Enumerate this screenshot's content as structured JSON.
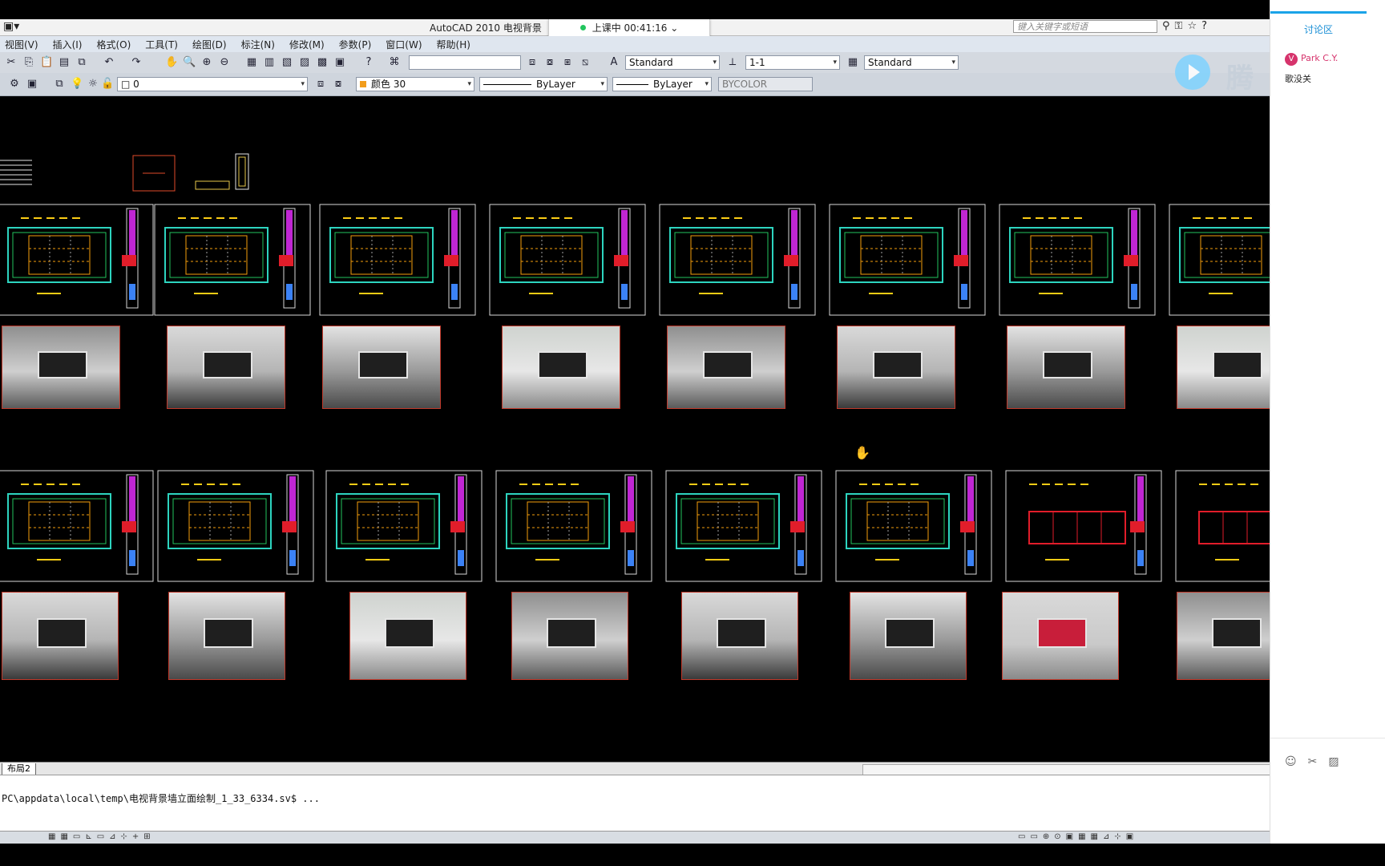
{
  "titlebar": {
    "title": "AutoCAD 2010    电视背景",
    "search_placeholder": "键入关键字或短语",
    "icons": [
      "binoculars-icon",
      "key-icon",
      "star-icon",
      "help-icon"
    ]
  },
  "timer": {
    "label": "上课中 00:41:16",
    "status_color": "#22c55e"
  },
  "menu": [
    "视图(V)",
    "插入(I)",
    "格式(O)",
    "工具(T)",
    "绘图(D)",
    "标注(N)",
    "修改(M)",
    "参数(P)",
    "窗口(W)",
    "帮助(H)"
  ],
  "toolbar1": {
    "text_style": "Standard",
    "dim_scale": "1-1",
    "table_style": "Standard"
  },
  "toolbar2": {
    "layer": "0",
    "color": "颜色 30",
    "linetype": "ByLayer",
    "lineweight": "ByLayer",
    "plotstyle": "BYCOLOR"
  },
  "logo": {
    "text": "腾讯"
  },
  "layout_tab": "布局2",
  "command_line": "PC\\appdata\\local\\temp\\电视背景墙立面绘制_1_33_6334.sv$ ...",
  "panel": {
    "title": "讨论区",
    "messages": [
      {
        "avatar": "V",
        "user": "Park C.Y.",
        "text": "歌没关"
      }
    ]
  },
  "colors": {
    "accent": "#1aa3e8",
    "cad_background": "#000000",
    "user_color": "#d6336c"
  }
}
